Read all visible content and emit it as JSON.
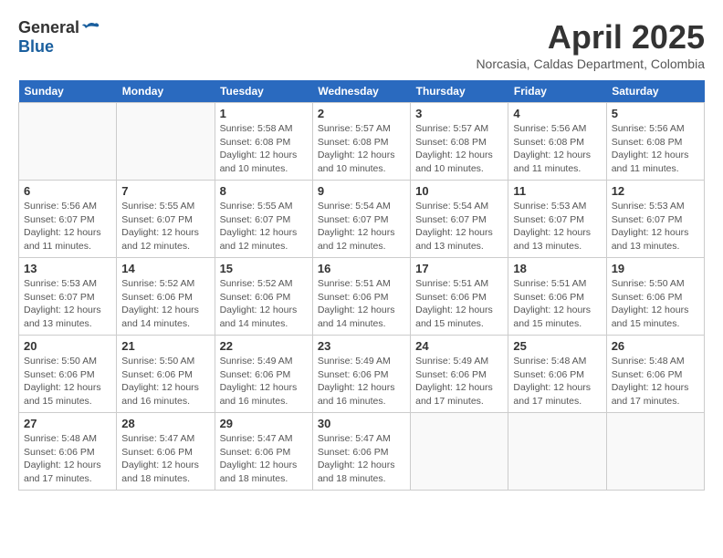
{
  "logo": {
    "general": "General",
    "blue": "Blue"
  },
  "header": {
    "month": "April 2025",
    "location": "Norcasia, Caldas Department, Colombia"
  },
  "weekdays": [
    "Sunday",
    "Monday",
    "Tuesday",
    "Wednesday",
    "Thursday",
    "Friday",
    "Saturday"
  ],
  "weeks": [
    [
      {
        "day": "",
        "info": ""
      },
      {
        "day": "",
        "info": ""
      },
      {
        "day": "1",
        "info": "Sunrise: 5:58 AM\nSunset: 6:08 PM\nDaylight: 12 hours and 10 minutes."
      },
      {
        "day": "2",
        "info": "Sunrise: 5:57 AM\nSunset: 6:08 PM\nDaylight: 12 hours and 10 minutes."
      },
      {
        "day": "3",
        "info": "Sunrise: 5:57 AM\nSunset: 6:08 PM\nDaylight: 12 hours and 10 minutes."
      },
      {
        "day": "4",
        "info": "Sunrise: 5:56 AM\nSunset: 6:08 PM\nDaylight: 12 hours and 11 minutes."
      },
      {
        "day": "5",
        "info": "Sunrise: 5:56 AM\nSunset: 6:08 PM\nDaylight: 12 hours and 11 minutes."
      }
    ],
    [
      {
        "day": "6",
        "info": "Sunrise: 5:56 AM\nSunset: 6:07 PM\nDaylight: 12 hours and 11 minutes."
      },
      {
        "day": "7",
        "info": "Sunrise: 5:55 AM\nSunset: 6:07 PM\nDaylight: 12 hours and 12 minutes."
      },
      {
        "day": "8",
        "info": "Sunrise: 5:55 AM\nSunset: 6:07 PM\nDaylight: 12 hours and 12 minutes."
      },
      {
        "day": "9",
        "info": "Sunrise: 5:54 AM\nSunset: 6:07 PM\nDaylight: 12 hours and 12 minutes."
      },
      {
        "day": "10",
        "info": "Sunrise: 5:54 AM\nSunset: 6:07 PM\nDaylight: 12 hours and 13 minutes."
      },
      {
        "day": "11",
        "info": "Sunrise: 5:53 AM\nSunset: 6:07 PM\nDaylight: 12 hours and 13 minutes."
      },
      {
        "day": "12",
        "info": "Sunrise: 5:53 AM\nSunset: 6:07 PM\nDaylight: 12 hours and 13 minutes."
      }
    ],
    [
      {
        "day": "13",
        "info": "Sunrise: 5:53 AM\nSunset: 6:07 PM\nDaylight: 12 hours and 13 minutes."
      },
      {
        "day": "14",
        "info": "Sunrise: 5:52 AM\nSunset: 6:06 PM\nDaylight: 12 hours and 14 minutes."
      },
      {
        "day": "15",
        "info": "Sunrise: 5:52 AM\nSunset: 6:06 PM\nDaylight: 12 hours and 14 minutes."
      },
      {
        "day": "16",
        "info": "Sunrise: 5:51 AM\nSunset: 6:06 PM\nDaylight: 12 hours and 14 minutes."
      },
      {
        "day": "17",
        "info": "Sunrise: 5:51 AM\nSunset: 6:06 PM\nDaylight: 12 hours and 15 minutes."
      },
      {
        "day": "18",
        "info": "Sunrise: 5:51 AM\nSunset: 6:06 PM\nDaylight: 12 hours and 15 minutes."
      },
      {
        "day": "19",
        "info": "Sunrise: 5:50 AM\nSunset: 6:06 PM\nDaylight: 12 hours and 15 minutes."
      }
    ],
    [
      {
        "day": "20",
        "info": "Sunrise: 5:50 AM\nSunset: 6:06 PM\nDaylight: 12 hours and 15 minutes."
      },
      {
        "day": "21",
        "info": "Sunrise: 5:50 AM\nSunset: 6:06 PM\nDaylight: 12 hours and 16 minutes."
      },
      {
        "day": "22",
        "info": "Sunrise: 5:49 AM\nSunset: 6:06 PM\nDaylight: 12 hours and 16 minutes."
      },
      {
        "day": "23",
        "info": "Sunrise: 5:49 AM\nSunset: 6:06 PM\nDaylight: 12 hours and 16 minutes."
      },
      {
        "day": "24",
        "info": "Sunrise: 5:49 AM\nSunset: 6:06 PM\nDaylight: 12 hours and 17 minutes."
      },
      {
        "day": "25",
        "info": "Sunrise: 5:48 AM\nSunset: 6:06 PM\nDaylight: 12 hours and 17 minutes."
      },
      {
        "day": "26",
        "info": "Sunrise: 5:48 AM\nSunset: 6:06 PM\nDaylight: 12 hours and 17 minutes."
      }
    ],
    [
      {
        "day": "27",
        "info": "Sunrise: 5:48 AM\nSunset: 6:06 PM\nDaylight: 12 hours and 17 minutes."
      },
      {
        "day": "28",
        "info": "Sunrise: 5:47 AM\nSunset: 6:06 PM\nDaylight: 12 hours and 18 minutes."
      },
      {
        "day": "29",
        "info": "Sunrise: 5:47 AM\nSunset: 6:06 PM\nDaylight: 12 hours and 18 minutes."
      },
      {
        "day": "30",
        "info": "Sunrise: 5:47 AM\nSunset: 6:06 PM\nDaylight: 12 hours and 18 minutes."
      },
      {
        "day": "",
        "info": ""
      },
      {
        "day": "",
        "info": ""
      },
      {
        "day": "",
        "info": ""
      }
    ]
  ]
}
